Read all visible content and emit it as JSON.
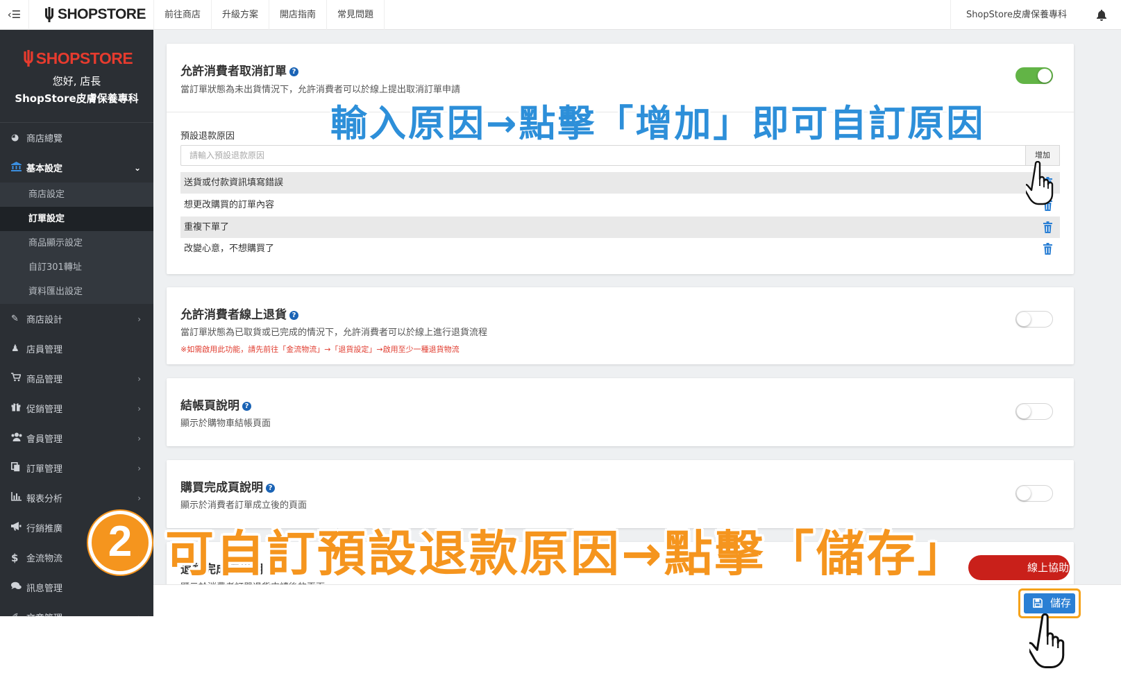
{
  "topbar": {
    "menu_icon": "collapse-menu-icon",
    "logo_text": "SHOPSTORE",
    "nav": [
      "前往商店",
      "升級方案",
      "開店指南",
      "常見問題"
    ],
    "store_name": "ShopStore皮膚保養專科",
    "bell_icon": "bell-icon"
  },
  "sidebar": {
    "logo_text": "SHOPSTORE",
    "greeting": "您好, 店長",
    "store_name": "ShopStore皮膚保養專科",
    "items": [
      {
        "label": "商店總覽",
        "icon": "dashboard-icon"
      },
      {
        "label": "基本設定",
        "icon": "bank-icon"
      },
      {
        "label": "商店設計",
        "icon": "magic-wand-icon"
      },
      {
        "label": "店員管理",
        "icon": "staff-icon"
      },
      {
        "label": "商品管理",
        "icon": "cart-icon"
      },
      {
        "label": "促銷管理",
        "icon": "gift-icon"
      },
      {
        "label": "會員管理",
        "icon": "users-icon"
      },
      {
        "label": "訂單管理",
        "icon": "copy-icon"
      },
      {
        "label": "報表分析",
        "icon": "bar-chart-icon"
      },
      {
        "label": "行銷推廣",
        "icon": "bullhorn-icon"
      },
      {
        "label": "金流物流",
        "icon": "dollar-icon"
      },
      {
        "label": "訊息管理",
        "icon": "comments-icon"
      },
      {
        "label": "文章管理",
        "icon": "edit-icon"
      }
    ],
    "sub_items": [
      "商店設定",
      "訂單設定",
      "商品顯示設定",
      "自訂301轉址",
      "資料匯出設定"
    ]
  },
  "cancel_card": {
    "title": "允許消費者取消訂單",
    "desc": "當訂單狀態為未出貨情況下，允許消費者可以於線上提出取消訂單申請",
    "enabled": true,
    "reason_label": "預設退款原因",
    "reason_placeholder": "請輸入預設退款原因",
    "add_label": "增加",
    "reasons": [
      "送貨或付款資訊填寫錯誤",
      "想更改購買的訂單內容",
      "重複下單了",
      "改變心意，不想購買了"
    ]
  },
  "return_card": {
    "title": "允許消費者線上退貨",
    "desc": "當訂單狀態為已取貨或已完成的情況下，允許消費者可以於線上進行退貨流程",
    "warning": "※如需啟用此功能，請先前往「金流物流」→「退貨設定」→啟用至少一種退貨物流",
    "enabled": false
  },
  "checkout_card": {
    "title": "結帳頁說明",
    "desc": "顯示於購物車結帳頁面",
    "enabled": false
  },
  "complete_card": {
    "title": "購買完成頁說明",
    "desc": "顯示於消費者訂單成立後的頁面",
    "enabled": false
  },
  "refund_card": {
    "title": "退貨完成頁說明",
    "desc": "顯示於消費者訂單退貨申請後的頁面"
  },
  "help_label": "線上協助",
  "save_label": "儲存",
  "annotations": {
    "blue": "輸入原因→點擊「增加」即可自訂原因",
    "step_number": "2",
    "orange": "可自訂預設退款原因→點擊「儲存」"
  },
  "colors": {
    "sidebar_bg": "#2b2f34",
    "toggle_on": "#62b446",
    "primary": "#2a7fd4",
    "annotation_blue": "#2d8fd9",
    "annotation_orange": "#f5951e",
    "brand_red": "#e63b2e"
  }
}
